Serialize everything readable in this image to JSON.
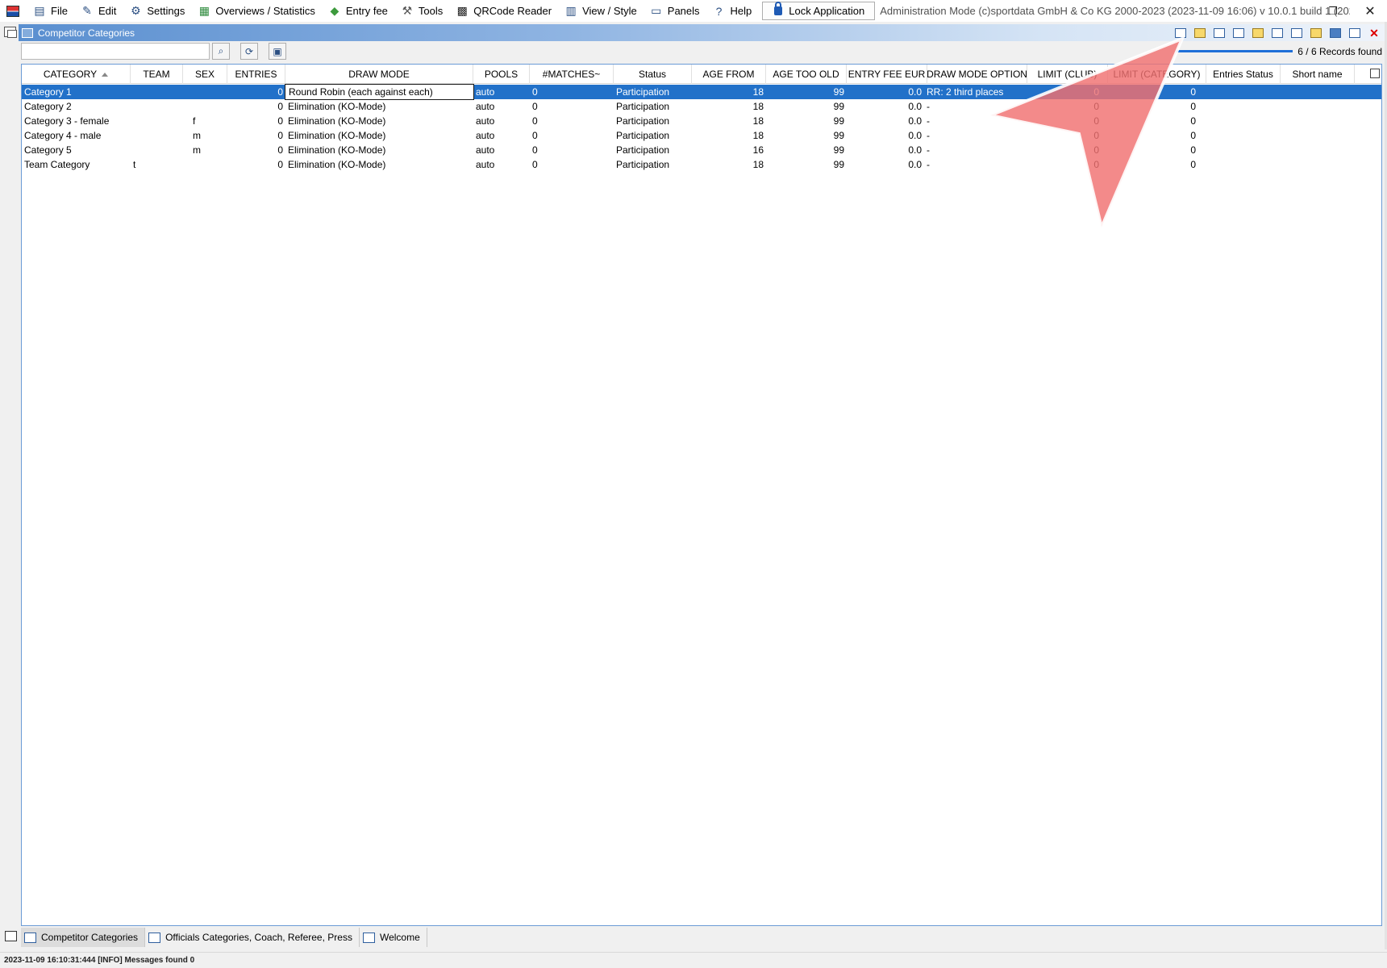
{
  "menubar": {
    "items": [
      {
        "label": "File",
        "icon": "folder-icon"
      },
      {
        "label": "Edit",
        "icon": "edit-icon"
      },
      {
        "label": "Settings",
        "icon": "gear-icon"
      },
      {
        "label": "Overviews / Statistics",
        "icon": "statistics-icon"
      },
      {
        "label": "Entry fee",
        "icon": "money-icon"
      },
      {
        "label": "Tools",
        "icon": "wrench-icon"
      },
      {
        "label": "QRCode Reader",
        "icon": "qrcode-icon"
      },
      {
        "label": "View / Style",
        "icon": "view-icon"
      },
      {
        "label": "Panels",
        "icon": "panels-icon"
      },
      {
        "label": "Help",
        "icon": "help-icon"
      }
    ],
    "lock_label": "Lock Application",
    "title": "Administration Mode (c)sportdata GmbH & Co KG 2000-2023 (2023-11-09 16:06)  v 10.0.1 build 1 (2023-07..."
  },
  "panel": {
    "title": "Competitor Categories",
    "records_found": "6 / 6 Records found",
    "filter_value": ""
  },
  "grid": {
    "columns": [
      "CATEGORY",
      "TEAM",
      "SEX",
      "ENTRIES",
      "DRAW MODE",
      "POOLS",
      "#MATCHES~",
      "Status",
      "AGE FROM",
      "AGE TOO OLD",
      "ENTRY FEE EUR",
      "DRAW MODE OPTION",
      "LIMIT (CLUB)",
      "LIMIT (CATEGORY)",
      "Entries Status",
      "Short name"
    ],
    "sorted_column": "CATEGORY",
    "rows": [
      {
        "category": "Category 1",
        "team": "",
        "sex": "",
        "entries": "0",
        "draw_mode": "Round Robin (each against each)",
        "pools": "auto",
        "matches": "0",
        "status": "Participation",
        "age_from": "18",
        "age_too_old": "99",
        "entry_fee": "0.0",
        "draw_mode_option": "RR: 2 third places",
        "limit_club": "0",
        "limit_category": "0",
        "entries_status": "",
        "short_name": "",
        "selected": true
      },
      {
        "category": "Category 2",
        "team": "",
        "sex": "",
        "entries": "0",
        "draw_mode": "Elimination (KO-Mode)",
        "pools": "auto",
        "matches": "0",
        "status": "Participation",
        "age_from": "18",
        "age_too_old": "99",
        "entry_fee": "0.0",
        "draw_mode_option": "-",
        "limit_club": "0",
        "limit_category": "0",
        "entries_status": "",
        "short_name": ""
      },
      {
        "category": "Category 3 - female",
        "team": "",
        "sex": "f",
        "entries": "0",
        "draw_mode": "Elimination (KO-Mode)",
        "pools": "auto",
        "matches": "0",
        "status": "Participation",
        "age_from": "18",
        "age_too_old": "99",
        "entry_fee": "0.0",
        "draw_mode_option": "-",
        "limit_club": "0",
        "limit_category": "0",
        "entries_status": "",
        "short_name": ""
      },
      {
        "category": "Category 4 - male",
        "team": "",
        "sex": "m",
        "entries": "0",
        "draw_mode": "Elimination (KO-Mode)",
        "pools": "auto",
        "matches": "0",
        "status": "Participation",
        "age_from": "18",
        "age_too_old": "99",
        "entry_fee": "0.0",
        "draw_mode_option": "-",
        "limit_club": "0",
        "limit_category": "0",
        "entries_status": "",
        "short_name": ""
      },
      {
        "category": "Category 5",
        "team": "",
        "sex": "m",
        "entries": "0",
        "draw_mode": "Elimination (KO-Mode)",
        "pools": "auto",
        "matches": "0",
        "status": "Participation",
        "age_from": "16",
        "age_too_old": "99",
        "entry_fee": "0.0",
        "draw_mode_option": "-",
        "limit_club": "0",
        "limit_category": "0",
        "entries_status": "",
        "short_name": ""
      },
      {
        "category": "Team Category",
        "team": "t",
        "sex": "",
        "entries": "0",
        "draw_mode": "Elimination (KO-Mode)",
        "pools": "auto",
        "matches": "0",
        "status": "Participation",
        "age_from": "18",
        "age_too_old": "99",
        "entry_fee": "0.0",
        "draw_mode_option": "-",
        "limit_club": "0",
        "limit_category": "0",
        "entries_status": "",
        "short_name": ""
      }
    ]
  },
  "tabs": [
    {
      "label": "Competitor Categories",
      "active": true
    },
    {
      "label": "Officials Categories, Coach, Referee, Press",
      "active": false
    },
    {
      "label": "Welcome",
      "active": false
    }
  ],
  "statusbar": {
    "text": "2023-11-09 16:10:31:444 [INFO] Messages found 0"
  },
  "colors": {
    "selection": "#2271c9",
    "annotation_arrow": "#f07070",
    "panel_header": "#5a8fd0"
  }
}
